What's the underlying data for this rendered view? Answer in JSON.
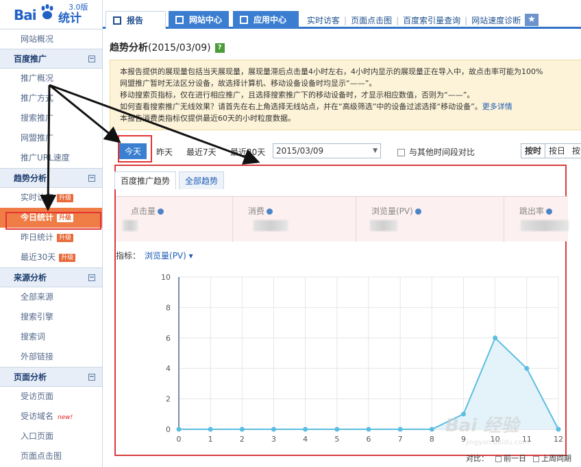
{
  "logo": {
    "text_bai": "Bai",
    "text_tongji": "统计",
    "version": "3.0版"
  },
  "sidebar": {
    "top_item": "网站概况",
    "groups": [
      {
        "title": "百度推广",
        "items": [
          {
            "label": "推广概况"
          },
          {
            "label": "推广方式"
          },
          {
            "label": "搜索推广"
          },
          {
            "label": "网盟推广"
          },
          {
            "label": "推广URL速度"
          }
        ]
      },
      {
        "title": "趋势分析",
        "items": [
          {
            "label": "实时访客",
            "badge": "升级"
          },
          {
            "label": "今日统计",
            "badge": "升级",
            "active": true
          },
          {
            "label": "昨日统计",
            "badge": "升级"
          },
          {
            "label": "最近30天",
            "badge": "升级"
          }
        ]
      },
      {
        "title": "来源分析",
        "items": [
          {
            "label": "全部来源"
          },
          {
            "label": "搜索引擎"
          },
          {
            "label": "搜索词"
          },
          {
            "label": "外部链接"
          }
        ]
      },
      {
        "title": "页面分析",
        "items": [
          {
            "label": "受访页面"
          },
          {
            "label": "受访域名",
            "badge_new": "new!"
          },
          {
            "label": "入口页面"
          },
          {
            "label": "页面点击图"
          }
        ]
      }
    ],
    "toggle_symbol": "⊟"
  },
  "topnav": {
    "tabs": [
      {
        "label": "报告"
      },
      {
        "label": "网站中心"
      },
      {
        "label": "应用中心"
      }
    ],
    "links": [
      "实时访客",
      "页面点击图",
      "百度索引量查询",
      "网站速度诊断"
    ],
    "star_icon": "★"
  },
  "main": {
    "title": "趋势分析",
    "date": "(2015/03/09)",
    "help_label": "?",
    "notice_lines": [
      "本报告提供的展现量包括当天展现量，展现量滞后点击量4小时左右，4小时内显示的展现量正在导入中，故点击率可能为100%",
      "网盟推广暂时无法区分设备，故选择计算机、移动设备设备时均显示“——”。",
      "移动搜索页指标，仅在进行相应推广，且选择搜索推广下的移动设备时，才显示相应数值，否则为“——”。",
      "如何查看搜索推广无线效果？请首先在右上角选择无线站点，并在“高级筛选”中的设备过滤选择“移动设备”。",
      "本报告消费类指标仅提供最近60天的小时粒度数据。"
    ],
    "more_link": "更多详情",
    "date_buttons": [
      "今天",
      "昨天",
      "最近7天",
      "最近30天"
    ],
    "date_value": "2015/03/09",
    "compare_label": "与其他时间段对比",
    "granularity": [
      "按时",
      "按日",
      "按"
    ],
    "subtabs": [
      "百度推广趋势",
      "全部趋势"
    ],
    "metrics": [
      "点击量",
      "消费",
      "浏览量(PV)",
      "跳出率"
    ],
    "indicator_label": "指标：",
    "indicator_value": "浏览量(PV) ▾",
    "bottom_compare": "对比：",
    "bottom_options": [
      "前一日",
      "上周同期"
    ]
  },
  "colors": {
    "accent": "#3a7fd0",
    "line": "#5bbde0",
    "active_nav": "#ef7d45",
    "annotation": "#e53333"
  },
  "chart_data": {
    "type": "area",
    "x": [
      0,
      1,
      2,
      3,
      4,
      5,
      6,
      7,
      8,
      9,
      10,
      11,
      12
    ],
    "series": [
      {
        "values": [
          0,
          0,
          0,
          0,
          0,
          0,
          0,
          0,
          0,
          1,
          6,
          4,
          0
        ]
      }
    ],
    "yticks": [
      0,
      2,
      4,
      6,
      8,
      10
    ],
    "ylim": [
      0,
      10
    ],
    "grid": true
  },
  "watermark": {
    "main": "Bai 经验",
    "sub": "jingyan.baidu.com"
  }
}
